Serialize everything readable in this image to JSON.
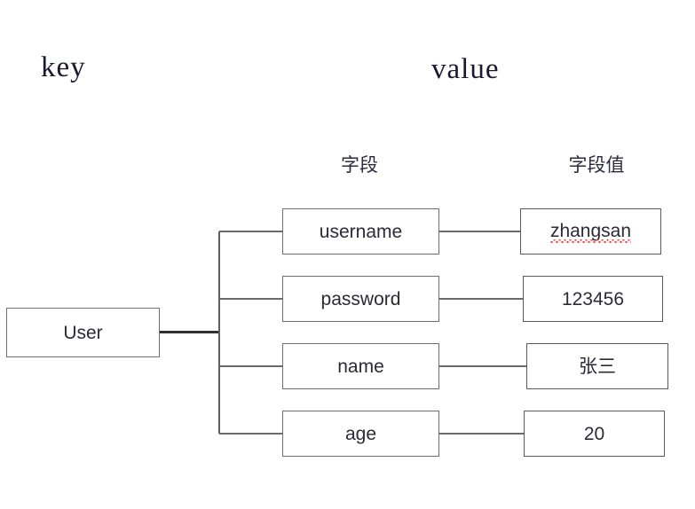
{
  "diagram": {
    "headings": {
      "key": "key",
      "value": "value"
    },
    "column_captions": {
      "field": "字段",
      "field_value": "字段值"
    },
    "root": {
      "label": "User"
    },
    "rows": [
      {
        "field": "username",
        "value": "zhangsan",
        "value_misspelled": true
      },
      {
        "field": "password",
        "value": "123456",
        "value_misspelled": false
      },
      {
        "field": "name",
        "value": "张三",
        "value_misspelled": false
      },
      {
        "field": "age",
        "value": "20",
        "value_misspelled": false
      }
    ],
    "colors": {
      "background": "#ffffff",
      "box_border": "#6e6e6e",
      "value_box_border": "#5a5a5a",
      "connector": "#6b6b6b",
      "trunk": "#303030",
      "text": "#2b2b36",
      "heading_text": "#191933",
      "spellcheck_underline": "#e8413c"
    }
  }
}
